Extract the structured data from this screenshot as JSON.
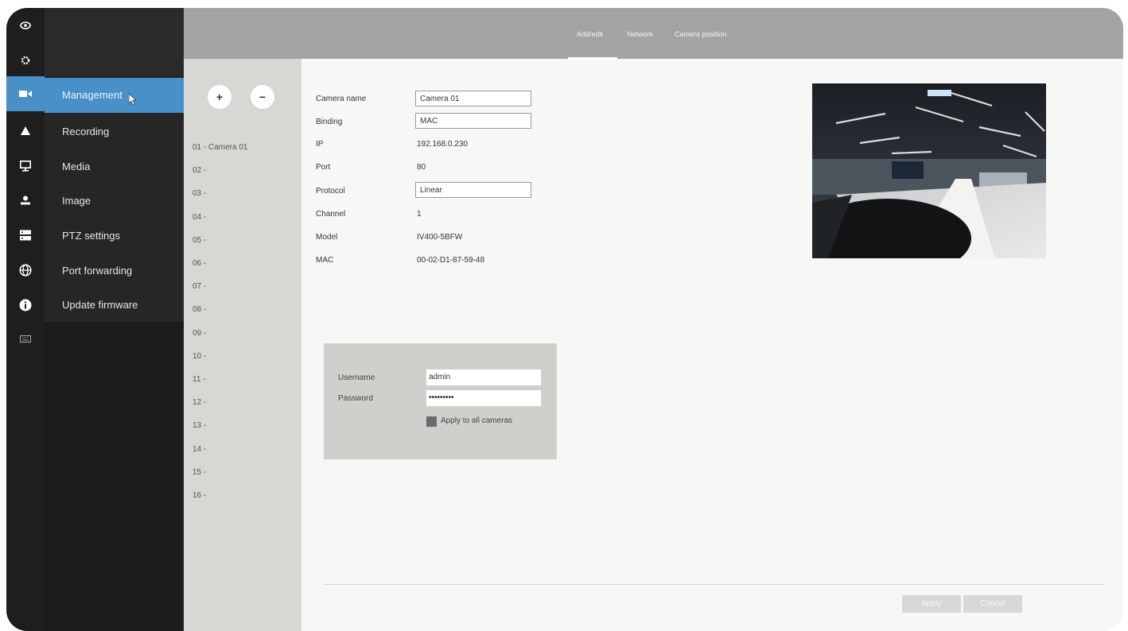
{
  "rail": {
    "icons": [
      "eye-icon",
      "gear-icon",
      "camera-icon",
      "bell-icon",
      "monitor-icon",
      "user-icon",
      "server-icon",
      "globe-icon",
      "info-icon",
      "keyboard-icon"
    ]
  },
  "menu": {
    "items": [
      {
        "label": "Management",
        "active": true
      },
      {
        "label": "Recording"
      },
      {
        "label": "Media"
      },
      {
        "label": "Image"
      },
      {
        "label": "PTZ settings"
      },
      {
        "label": "Port forwarding"
      },
      {
        "label": "Update firmware"
      }
    ]
  },
  "camera_list": {
    "add_label": "+",
    "remove_label": "−",
    "rows": [
      "01 - Camera 01",
      "02 -",
      "03 -",
      "04 -",
      "05 -",
      "06 -",
      "07 -",
      "08 -",
      "09 -",
      "10 -",
      "11 -",
      "12 -",
      "13 -",
      "14 -",
      "15 -",
      "16 -"
    ]
  },
  "tabs": [
    {
      "label": "Add/edit",
      "active": true
    },
    {
      "label": "Network"
    },
    {
      "label": "Camera position"
    }
  ],
  "form": {
    "camera_name": {
      "label": "Camera name",
      "value": "Camera 01"
    },
    "binding": {
      "label": "Binding",
      "value": "MAC"
    },
    "ip": {
      "label": "IP",
      "value": "192.168.0.230"
    },
    "port": {
      "label": "Port",
      "value": "80"
    },
    "protocol": {
      "label": "Protocol",
      "value": "Linear"
    },
    "channel": {
      "label": "Channel",
      "value": "1"
    },
    "model": {
      "label": "Model",
      "value": "IV400-5BFW"
    },
    "mac": {
      "label": "MAC",
      "value": "00-02-D1-87-59-48"
    }
  },
  "auth": {
    "username": {
      "label": "Username",
      "value": "admin"
    },
    "password": {
      "label": "Password",
      "value": "•••••••••"
    },
    "apply_all_label": "Apply to all cameras"
  },
  "actions": {
    "apply": "Apply",
    "cancel": "Cancel"
  },
  "colors": {
    "accent": "#4a90c8",
    "topbar": "#a3a3a1",
    "rail": "#1e1e1e",
    "menu": "#262626"
  }
}
